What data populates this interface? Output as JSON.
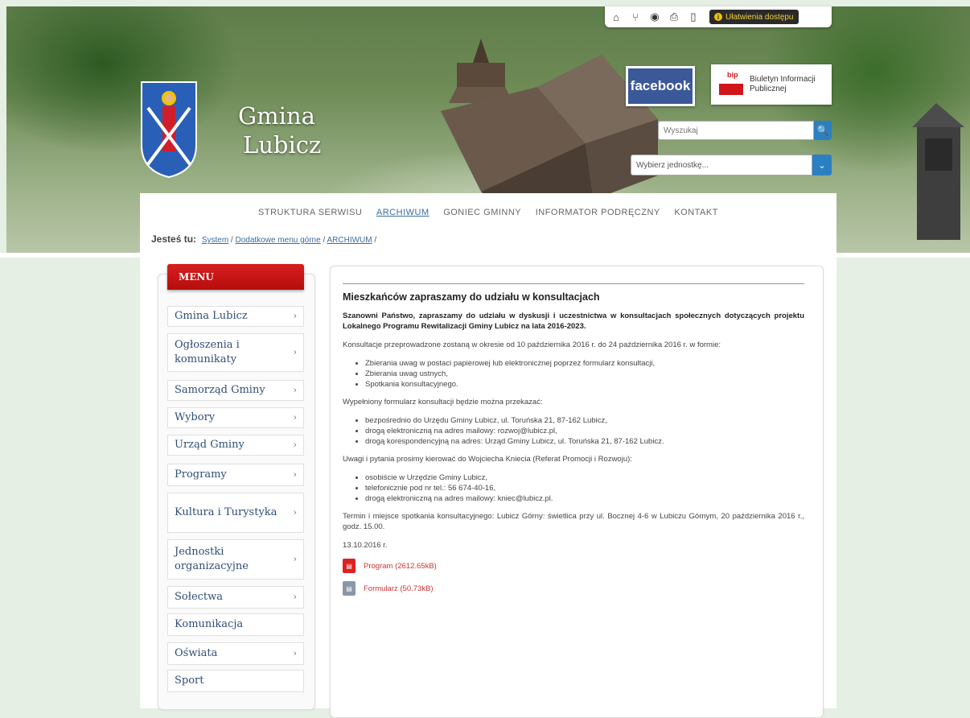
{
  "topbar": {
    "icons": [
      "home-icon",
      "sitemap-icon",
      "rss-icon",
      "print-icon",
      "mobile-icon"
    ],
    "accessibility_label": "Ułatwienia dostępu"
  },
  "logo": {
    "line1": "Gmina",
    "line2": "Lubicz"
  },
  "facebook": {
    "label": "facebook"
  },
  "bip": {
    "tag": "bip",
    "label": "Biuletyn Informacji Publicznej"
  },
  "search": {
    "placeholder": "Wyszukaj"
  },
  "unit_select": {
    "value": "Wybierz jednostkę..."
  },
  "nav": {
    "items": [
      "STRUKTURA SERWISU",
      "ARCHIWUM",
      "GONIEC GMINNY",
      "INFORMATOR PODRĘCZNY",
      "KONTAKT"
    ]
  },
  "breadcrumb": {
    "label": "Jesteś tu:",
    "items": [
      "System",
      "Dodatkowe menu górne",
      "ARCHIWUM"
    ]
  },
  "menu": {
    "title": "MENU",
    "items": [
      {
        "label": "Gmina Lubicz",
        "arrow": "›"
      },
      {
        "label": "Ogłoszenia i komunikaty",
        "arrow": "›"
      },
      {
        "label": "Samorząd Gminy",
        "arrow": "›"
      },
      {
        "label": "Wybory",
        "arrow": "›"
      },
      {
        "label": "Urząd Gminy",
        "arrow": "›"
      },
      {
        "label": "Programy",
        "arrow": "›"
      },
      {
        "label": "Kultura i Turystyka",
        "arrow": "›"
      },
      {
        "label": "Jednostki organizacyjne",
        "arrow": "›"
      },
      {
        "label": "Sołectwa",
        "arrow": "›"
      },
      {
        "label": "Komunikacja",
        "arrow": ""
      },
      {
        "label": "Oświata",
        "arrow": "›"
      },
      {
        "label": "Sport",
        "arrow": ""
      }
    ]
  },
  "article": {
    "title": "Mieszkańców zapraszamy do udziału w konsultacjach",
    "lead": "Szanowni Państwo, zapraszamy do udziału w dyskusji i uczestnictwa w konsultacjach społecznych dotyczących projektu Lokalnego Programu Rewitalizacji Gminy Lubicz na lata 2016-2023.",
    "p1": "Konsultacje przeprowadzone zostaną w okresie od 10 października 2016 r. do 24 października 2016 r. w formie:",
    "list1": [
      "Zbierania uwag w postaci papierowej lub elektronicznej poprzez formularz konsultacji,",
      "Zbierania uwag ustnych,",
      "Spotkania konsultacyjnego."
    ],
    "p2": "Wypełniony formularz konsultacji będzie można przekazać:",
    "list2": [
      "bezpośrednio do Urzędu Gminy Lubicz, ul. Toruńska 21, 87-162 Lubicz,",
      "drogą elektroniczną na adres mailowy: rozwoj@lubicz.pl,",
      "drogą korespondencyjną na adres: Urząd Gminy Lubicz, ul. Toruńska 21, 87-162 Lubicz."
    ],
    "p3": "Uwagi i pytania prosimy kierować do Wojciecha Kniecia (Referat Promocji i Rozwoju):",
    "list3": [
      "osobiście w Urzędzie Gminy Lubicz,",
      "telefonicznie pod nr tel.: 56 674-40-16,",
      "drogą elektroniczną na adres mailowy: kniec@lubicz.pl."
    ],
    "p4": "Termin i miejsce spotkania konsultacyjnego: Lubicz Górny: świetlica przy ul. Bocznej 4-6 w Lubiczu Górnym, 20 października 2016 r., godz. 15.00.",
    "date": "13.10.2016 r.",
    "attachments": [
      "Program (2612.65kB)",
      "Formularz (50.73kB)"
    ]
  }
}
